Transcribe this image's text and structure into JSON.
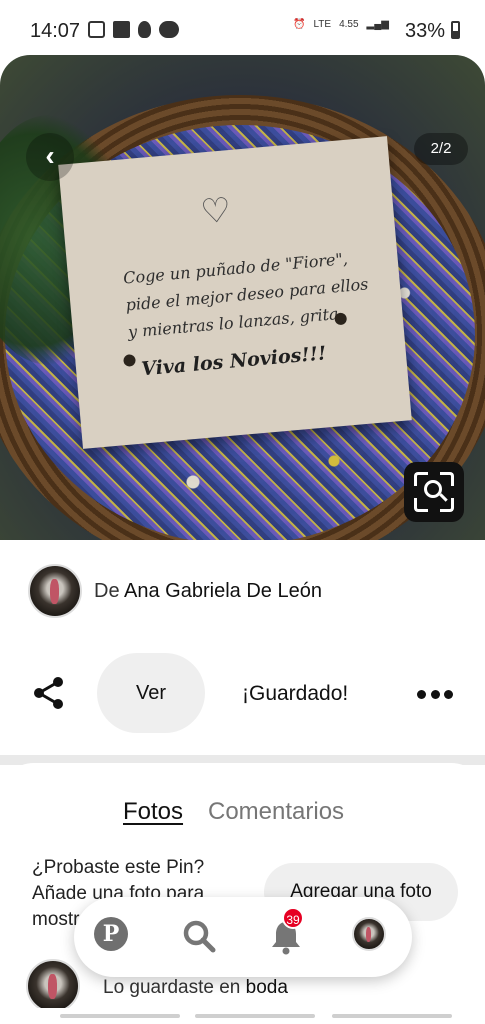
{
  "status_bar": {
    "time": "14:07",
    "battery": "33%",
    "network_speed": "4.55",
    "network_label": "LTE"
  },
  "image": {
    "page_indicator": "2/2",
    "card_lines": [
      "Coge un puñado de \"Fiore\",",
      "pide el mejor deseo para ellos",
      "y mientras lo lanzas, grita"
    ],
    "card_exclamation": "Viva los Novios!!!"
  },
  "pin": {
    "from_prefix": "De",
    "author": "Ana Gabriela De León",
    "view_button": "Ver",
    "saved_label": "¡Guardado!"
  },
  "tabs": {
    "photos": "Fotos",
    "comments": "Comentarios"
  },
  "tried": {
    "prompt": "¿Probaste este Pin? Añade una foto para mostrar cómo te fue",
    "add_photo_button": "Agregar una foto"
  },
  "saved_in": {
    "prefix": "Lo guardaste en",
    "board": "boda"
  },
  "bottom_nav": {
    "notification_count": "39",
    "pin_logo": "P"
  },
  "colors": {
    "accent": "#e60023",
    "button_bg": "#efefef"
  }
}
